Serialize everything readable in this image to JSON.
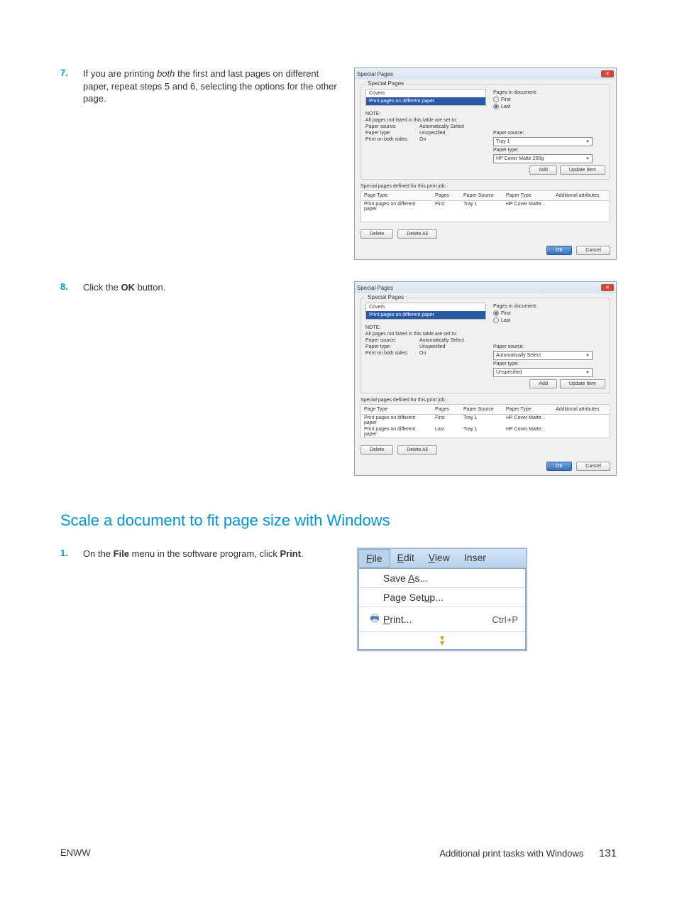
{
  "steps": {
    "s7": {
      "num": "7.",
      "text_prefix": "If you are printing ",
      "text_emph": "both",
      "text_suffix": " the first and last pages on different paper, repeat steps 5 and 6, selecting the options for the other page."
    },
    "s8": {
      "num": "8.",
      "text_prefix": "Click the ",
      "text_bold": "OK",
      "text_suffix": " button."
    },
    "s1": {
      "num": "1.",
      "text_a": "On the ",
      "text_b": "File",
      "text_c": " menu in the software program, click ",
      "text_d": "Print",
      "text_e": "."
    }
  },
  "section_heading": "Scale a document to fit page size with Windows",
  "dialogA": {
    "title": "Special Pages",
    "group": "Special Pages",
    "list": {
      "item0": "Covers",
      "item1": "Print pages on different paper"
    },
    "pages_label": "Pages in document:",
    "radio_first": "First",
    "radio_last": "Last",
    "note_title": "NOTE:",
    "note_line": "All pages not listed in this table are set to:",
    "kv": {
      "paper_source_l": "Paper source:",
      "paper_source_v": "Automatically Select",
      "paper_type_l": "Paper type:",
      "paper_type_v": "Unspecified",
      "both_sides_l": "Print on both sides:",
      "both_sides_v": "On"
    },
    "right": {
      "ps_label": "Paper source:",
      "ps_value": "Tray 1",
      "pt_label": "Paper type:",
      "pt_value": "HP Cover Matte 200g"
    },
    "btn_add": "Add",
    "btn_update": "Update Item",
    "defined_label": "Special pages defined for this print job:",
    "cols": {
      "c1": "Page Type",
      "c2": "Pages",
      "c3": "Paper Source",
      "c4": "Paper Type",
      "c5": "Additional attributes"
    },
    "row1": {
      "c1": "Print pages on different paper",
      "c2": "First",
      "c3": "Tray 1",
      "c4": "HP Cover Matte..."
    },
    "btn_delete": "Delete",
    "btn_delete_all": "Delete All",
    "btn_ok": "OK",
    "btn_cancel": "Cancel"
  },
  "dialogB": {
    "title": "Special Pages",
    "group": "Special Pages",
    "list": {
      "item0": "Covers",
      "item1": "Print pages on different paper"
    },
    "pages_label": "Pages in document:",
    "radio_first": "First",
    "radio_last": "Last",
    "note_title": "NOTE:",
    "note_line": "All pages not listed in this table are set to:",
    "kv": {
      "paper_source_l": "Paper source:",
      "paper_source_v": "Automatically Select",
      "paper_type_l": "Paper type:",
      "paper_type_v": "Unspecified",
      "both_sides_l": "Print on both sides:",
      "both_sides_v": "On"
    },
    "right": {
      "ps_label": "Paper source:",
      "ps_value": "Automatically Select",
      "pt_label": "Paper type:",
      "pt_value": "Unspecified"
    },
    "btn_add": "Add",
    "btn_update": "Update Item",
    "defined_label": "Special pages defined for this print job:",
    "cols": {
      "c1": "Page Type",
      "c2": "Pages",
      "c3": "Paper Source",
      "c4": "Paper Type",
      "c5": "Additional attributes"
    },
    "row1": {
      "c1": "Print pages on different paper",
      "c2": "First",
      "c3": "Tray 1",
      "c4": "HP Cover Matte..."
    },
    "row2": {
      "c1": "Print pages on different paper",
      "c2": "Last",
      "c3": "Tray 1",
      "c4": "HP Cover Matte..."
    },
    "btn_delete": "Delete",
    "btn_delete_all": "Delete All",
    "btn_ok": "OK",
    "btn_cancel": "Cancel"
  },
  "menu": {
    "file": "File",
    "edit": "Edit",
    "view": "View",
    "inser": "Inser",
    "save_as": "Save As...",
    "page_setup": "Page Setup...",
    "print": "Print...",
    "print_shortcut": "Ctrl+P"
  },
  "footer": {
    "left": "ENWW",
    "right": "Additional print tasks with Windows",
    "page": "131"
  }
}
